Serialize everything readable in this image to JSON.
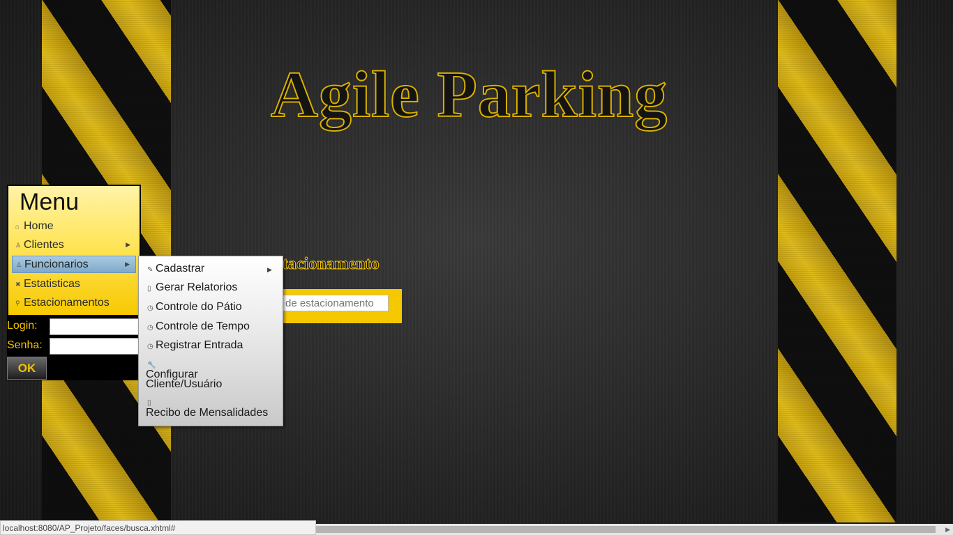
{
  "app": {
    "title": "Agile Parking"
  },
  "main": {
    "section_title": "tacionamento",
    "search_placeholder": "de estacionamento"
  },
  "menu": {
    "title": "Menu",
    "items": [
      {
        "label": "Home",
        "icon": "home-icon",
        "has_submenu": false
      },
      {
        "label": "Clientes",
        "icon": "user-icon",
        "has_submenu": true
      },
      {
        "label": "Funcionarios",
        "icon": "user-icon",
        "has_submenu": true,
        "active": true
      },
      {
        "label": "Estatisticas",
        "icon": "close-x-icon",
        "has_submenu": false
      },
      {
        "label": "Estacionamentos",
        "icon": "search-icon",
        "has_submenu": false
      }
    ]
  },
  "login": {
    "login_label": "Login:",
    "password_label": "Senha:",
    "ok_label": "OK"
  },
  "submenu": {
    "items": [
      {
        "label": "Cadastrar",
        "icon": "pencil-icon",
        "has_submenu": true
      },
      {
        "label": "Gerar Relatorios",
        "icon": "document-icon"
      },
      {
        "label": "Controle do Pátio",
        "icon": "clock-icon"
      },
      {
        "label": "Controle de Tempo",
        "icon": "clock-icon"
      },
      {
        "label": "Registrar Entrada",
        "icon": "clock-icon"
      }
    ],
    "configure_line1": "Configurar",
    "configure_line2": "Cliente/Usuário",
    "receipt_label": "Recibo de Mensalidades"
  },
  "status": {
    "url": "localhost:8080/AP_Projeto/faces/busca.xhtml#"
  },
  "colors": {
    "accent_yellow": "#f6c800",
    "menu_active_blue": "#7fa9c9",
    "background_dark": "#262626"
  }
}
